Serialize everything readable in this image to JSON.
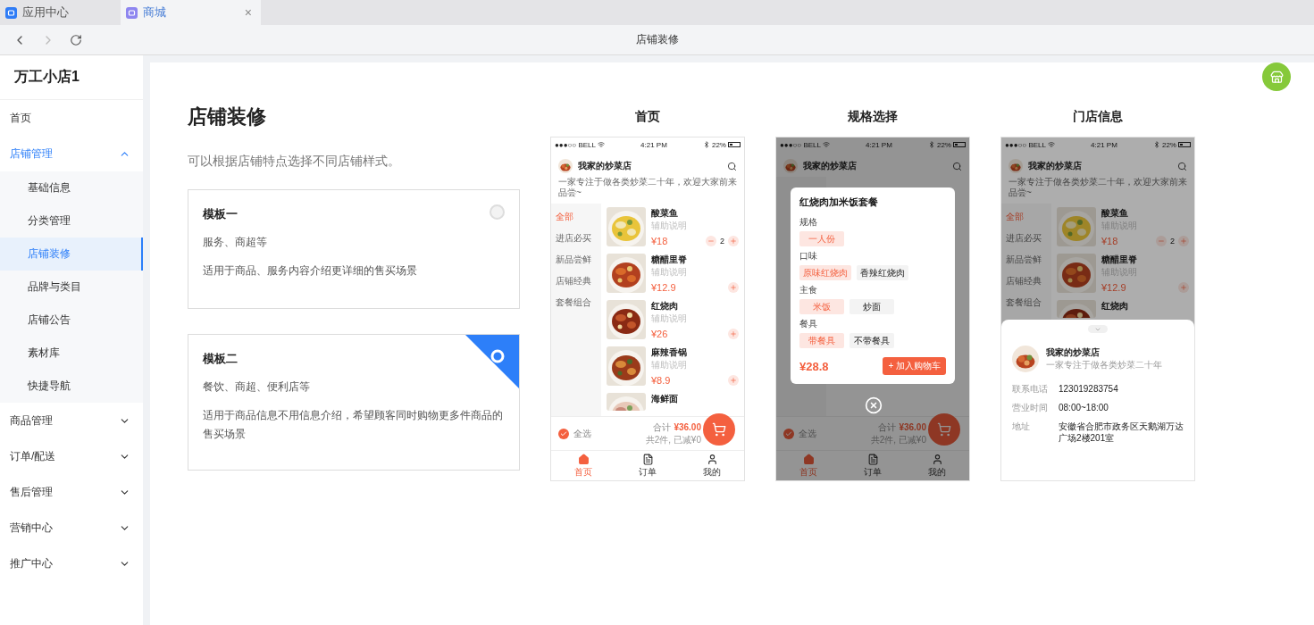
{
  "browser_tabs": [
    {
      "label": "应用中心",
      "selected": false
    },
    {
      "label": "商城",
      "selected": true,
      "close": "×"
    }
  ],
  "page_title": "店铺装修",
  "sidebar": {
    "title": "万工小店1",
    "items": [
      {
        "label": "首页",
        "selected": false
      },
      {
        "label": "店铺管理",
        "expanded": true,
        "children": [
          {
            "label": "基础信息",
            "selected": false
          },
          {
            "label": "分类管理",
            "selected": false
          },
          {
            "label": "店铺装修",
            "selected": true
          },
          {
            "label": "品牌与类目",
            "selected": false
          },
          {
            "label": "店铺公告",
            "selected": false
          },
          {
            "label": "素材库",
            "selected": false
          },
          {
            "label": "快捷导航",
            "selected": false
          }
        ]
      },
      {
        "label": "商品管理",
        "expanded": false
      },
      {
        "label": "订单/配送",
        "expanded": false
      },
      {
        "label": "售后管理",
        "expanded": false
      },
      {
        "label": "营销中心",
        "expanded": false
      },
      {
        "label": "推广中心",
        "expanded": false
      }
    ]
  },
  "heading": "店铺装修",
  "description": "可以根据店铺特点选择不同店铺样式。",
  "templates": [
    {
      "title": "模板一",
      "tags": "服务、商超等",
      "description": "适用于商品、服务内容介绍更详细的售买场景",
      "selected": false
    },
    {
      "title": "模板二",
      "tags": "餐饮、商超、便利店等",
      "description": "适用于商品信息不用信息介绍，希望顾客同时购物更多件商品的售买场景",
      "selected": true
    }
  ],
  "phones": [
    {
      "title": "首页",
      "screen": {
        "status": {
          "carrier": "●●●○○ BELL",
          "time": "4:21 PM",
          "battery": "22%"
        },
        "store_name": "我家的炒菜店",
        "subtitle": "一家专注于做各类炒菜二十年，欢迎大家前来品尝~",
        "categories": [
          {
            "label": "全部",
            "selected": true
          },
          {
            "label": "进店必买",
            "selected": false
          },
          {
            "label": "新品尝鲜",
            "selected": false
          },
          {
            "label": "店铺经典",
            "selected": false
          },
          {
            "label": "套餐组合",
            "selected": false
          }
        ],
        "items": [
          {
            "name": "酸菜鱼",
            "desc": "辅助说明",
            "price": "¥18",
            "qty": "2"
          },
          {
            "name": "糖醋里脊",
            "desc": "辅助说明",
            "price": "¥12.9"
          },
          {
            "name": "红烧肉",
            "desc": "辅助说明",
            "price": "¥26"
          },
          {
            "name": "麻辣香锅",
            "desc": "辅助说明",
            "price": "¥8.9"
          },
          {
            "name": "海鲜面"
          }
        ],
        "cart": {
          "select_all": "全选",
          "total_label": "合计",
          "total": "¥36.00",
          "summary": "共2件, 已减¥0"
        },
        "tabs": [
          {
            "label": "首页",
            "selected": true
          },
          {
            "label": "订单",
            "selected": false
          },
          {
            "label": "我的",
            "selected": false
          }
        ]
      }
    },
    {
      "title": "规格选择",
      "screen": {
        "status": {
          "carrier": "●●●○○ BELL",
          "time": "4:21 PM",
          "battery": "22%"
        },
        "store_name": "我家的炒菜店",
        "cart": {
          "select_all": "全选",
          "total_label": "合计",
          "total": "¥36.00",
          "summary": "共2件, 已减¥0"
        },
        "tabs": [
          {
            "label": "首页",
            "selected": true
          },
          {
            "label": "订单",
            "selected": false
          },
          {
            "label": "我的",
            "selected": false
          }
        ]
      },
      "overlay": {
        "kind": "spec_dialog",
        "title": "红烧肉加米饭套餐",
        "groups": [
          {
            "label": "规格",
            "options": [
              {
                "label": "一人份",
                "selected": true
              }
            ]
          },
          {
            "label": "口味",
            "options": [
              {
                "label": "原味红烧肉",
                "selected": true
              },
              {
                "label": "香辣红烧肉",
                "selected": false
              }
            ]
          },
          {
            "label": "主食",
            "options": [
              {
                "label": "米饭",
                "selected": true
              },
              {
                "label": "炒面",
                "selected": false
              }
            ]
          },
          {
            "label": "餐具",
            "options": [
              {
                "label": "带餐具",
                "selected": true
              },
              {
                "label": "不带餐具",
                "selected": false
              }
            ]
          }
        ],
        "price": "¥28.8",
        "button": "+ 加入购物车"
      }
    },
    {
      "title": "门店信息",
      "screen": {
        "status": {
          "carrier": "●●●○○ BELL",
          "time": "4:21 PM",
          "battery": "22%"
        },
        "store_name": "我家的炒菜店",
        "subtitle": "一家专注于做各类炒菜二十年，欢迎大家前来品尝~",
        "categories": [
          {
            "label": "全部",
            "selected": true
          },
          {
            "label": "进店必买",
            "selected": false
          },
          {
            "label": "新品尝鲜",
            "selected": false
          },
          {
            "label": "店铺经典",
            "selected": false
          },
          {
            "label": "套餐组合",
            "selected": false
          }
        ],
        "items": [
          {
            "name": "酸菜鱼",
            "desc": "辅助说明",
            "price": "¥18",
            "qty": "2"
          },
          {
            "name": "糖醋里脊",
            "desc": "辅助说明",
            "price": "¥12.9"
          },
          {
            "name": "红烧肉"
          }
        ]
      },
      "overlay": {
        "kind": "store_sheet",
        "store_name": "我家的炒菜店",
        "tagline": "一家专注于做各类炒菜二十年",
        "rows": [
          {
            "label": "联系电话",
            "value": "123019283754"
          },
          {
            "label": "营业时间",
            "value": "08:00~18:00"
          },
          {
            "label": "地址",
            "value": "安徽省合肥市政务区天鹅湖万达广场2楼201室"
          }
        ]
      }
    }
  ]
}
